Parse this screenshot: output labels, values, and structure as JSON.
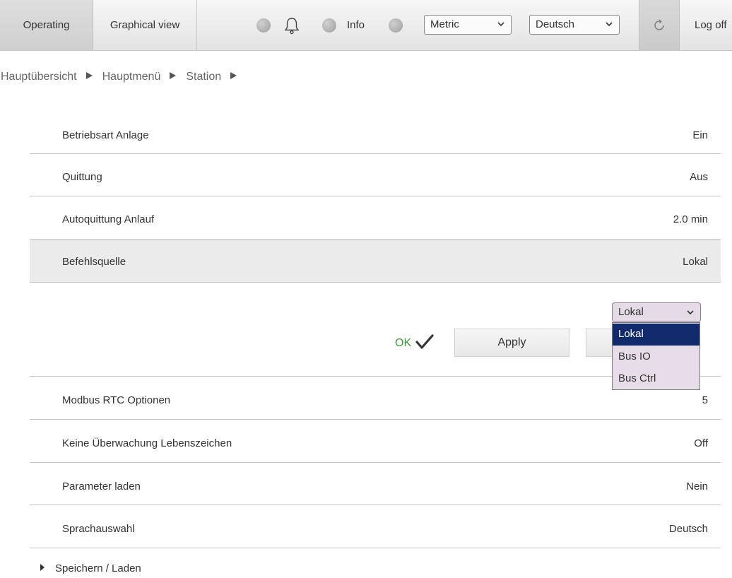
{
  "toolbar": {
    "operating": "Operating",
    "graphical_view": "Graphical view",
    "info": "Info",
    "unit_select": "Metric",
    "language_select": "Deutsch",
    "log_off": "Log off"
  },
  "breadcrumb": [
    "Hauptübersicht",
    "Hauptmenü",
    "Station"
  ],
  "rows_top": [
    {
      "label": "Betriebsart Anlage",
      "value": "Ein"
    },
    {
      "label": "Quittung",
      "value": "Aus"
    },
    {
      "label": "Autoquittung Anlauf",
      "value": "2.0 min"
    },
    {
      "label": "Befehlsquelle",
      "value": "Lokal"
    }
  ],
  "editor": {
    "status": "OK",
    "apply": "Apply",
    "current_value": "Lokal",
    "options": [
      "Lokal",
      "Bus IO",
      "Bus Ctrl"
    ],
    "selected_option": "Lokal"
  },
  "rows_bottom": [
    {
      "label": "Modbus RTC Optionen",
      "value": "5"
    },
    {
      "label": "Keine Überwachung Lebenszeichen",
      "value": "Off"
    },
    {
      "label": "Parameter laden",
      "value": "Nein"
    },
    {
      "label": "Sprachauswahl",
      "value": "Deutsch"
    }
  ],
  "footer": {
    "save_load": "Speichern / Laden"
  },
  "colors": {
    "ok_green": "#3c9a3c",
    "selected_option_bg": "#102a6b",
    "dropdown_bg": "#e6dde9"
  }
}
